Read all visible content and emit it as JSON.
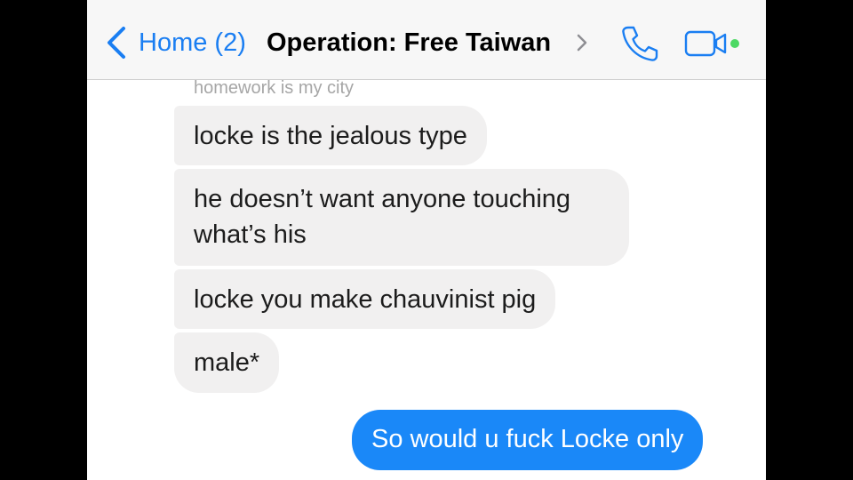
{
  "header": {
    "back_label": "Home (2)",
    "title": "Operation: Free Taiwan",
    "accent_color": "#1a7ef2",
    "online_indicator_color": "#4cd964",
    "icons": [
      "chevron-left-icon",
      "chevron-right-icon",
      "phone-icon",
      "video-camera-icon"
    ]
  },
  "conversation": {
    "sender_name": "homework is my city",
    "messages": [
      {
        "direction": "incoming",
        "text": "locke is the jealous type"
      },
      {
        "direction": "incoming",
        "text": "he doesn’t want anyone touching what’s his"
      },
      {
        "direction": "incoming",
        "text": "locke you make chauvinist pig"
      },
      {
        "direction": "incoming",
        "text": "male*"
      },
      {
        "direction": "outgoing",
        "text": "So would u fuck Locke only"
      }
    ],
    "colors": {
      "incoming_bubble": "#f1f0f0",
      "outgoing_bubble": "#1a88f8"
    }
  }
}
